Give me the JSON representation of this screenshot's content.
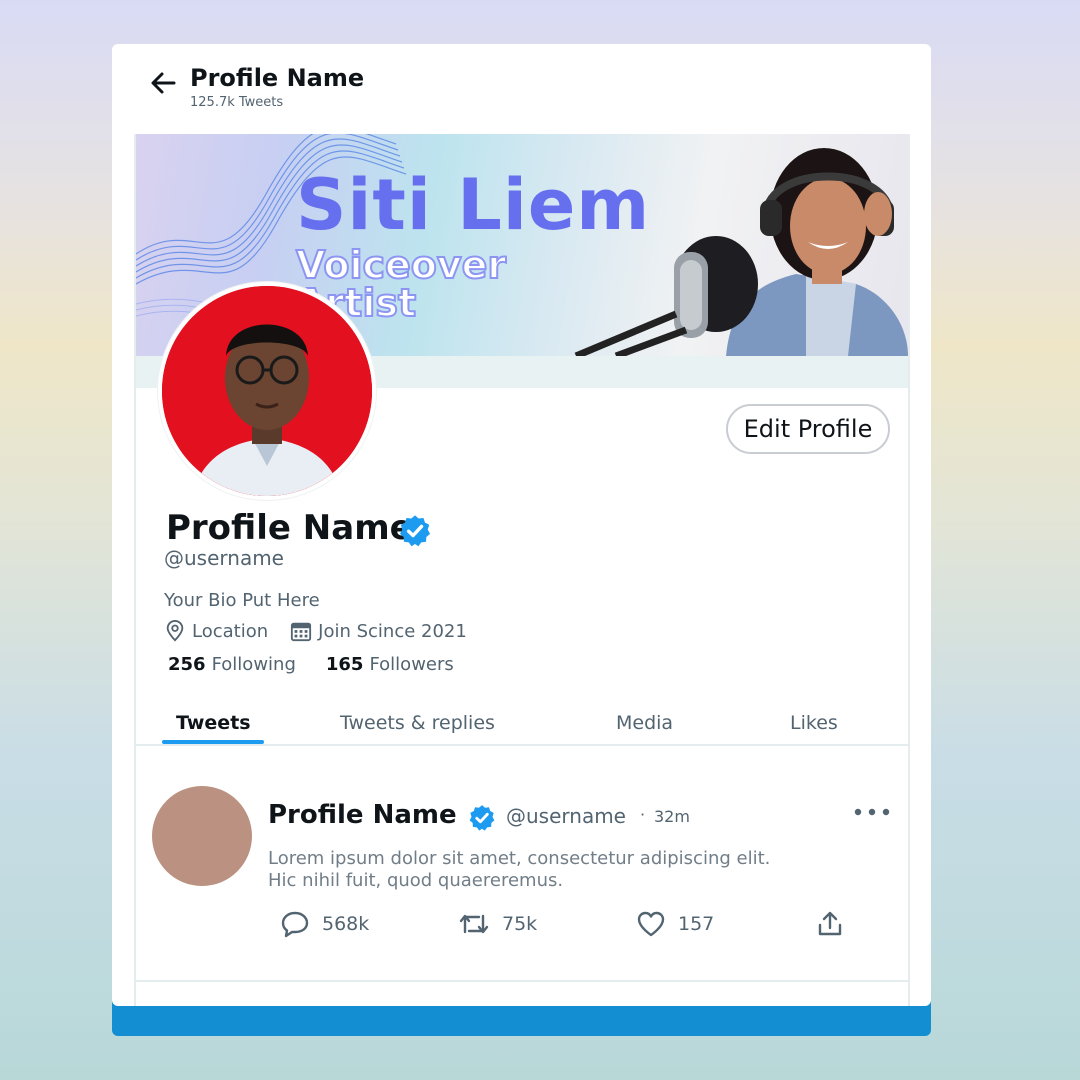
{
  "header": {
    "title": "Profile Name",
    "subtitle": "125.7k Tweets"
  },
  "banner": {
    "title": "Siti Liem",
    "subtitle_line1": "Voiceover",
    "subtitle_line2": "Artist"
  },
  "profile": {
    "edit_button": "Edit Profile",
    "name": "Profile Name",
    "handle": "@username",
    "bio": "Your Bio Put Here",
    "location": "Location",
    "joined": "Join Scince 2021",
    "following_count": "256",
    "following_label": "Following",
    "followers_count": "165",
    "followers_label": "Followers"
  },
  "tabs": [
    {
      "label": "Tweets"
    },
    {
      "label": "Tweets & replies"
    },
    {
      "label": "Media"
    },
    {
      "label": "Likes"
    }
  ],
  "tweet": {
    "name": "Profile Name",
    "handle": "@username",
    "separator": "·",
    "time": "32m",
    "text_line1": "Lorem ipsum dolor sit amet, consectetur adipiscing elit.",
    "text_line2": "Hic nihil fuit, quod quaereremus.",
    "replies": "568k",
    "retweets": "75k",
    "likes": "157"
  },
  "colors": {
    "accent": "#1d9bf0",
    "footer_bar": "#138ed3",
    "avatar_bg": "#e3101f",
    "tweet_avatar": "#bb9281",
    "banner_title": "#6670ef"
  },
  "icons": [
    "back-arrow-icon",
    "verified-icon",
    "location-pin-icon",
    "calendar-icon",
    "more-icon",
    "reply-icon",
    "retweet-icon",
    "like-icon",
    "share-icon"
  ]
}
